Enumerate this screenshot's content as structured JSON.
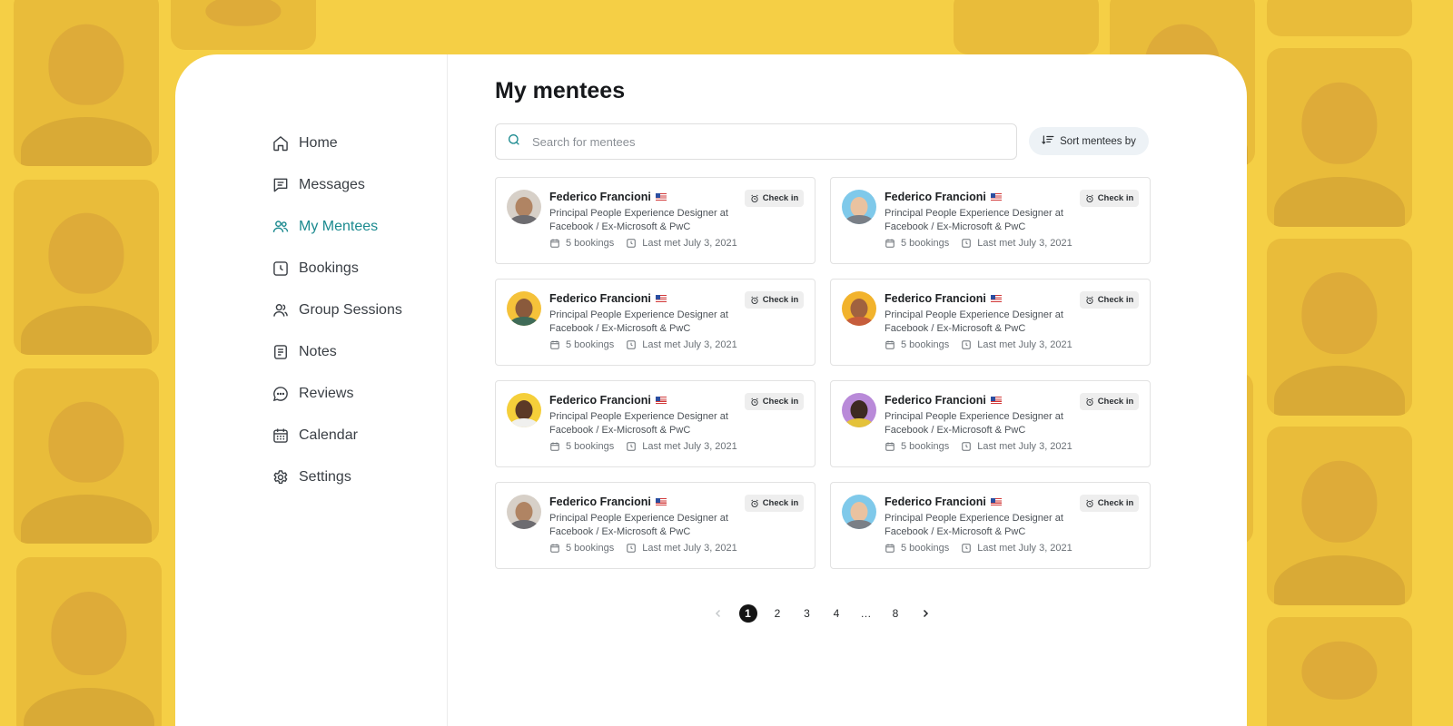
{
  "sidebar": {
    "items": [
      {
        "label": "Home",
        "icon": "home-icon"
      },
      {
        "label": "Messages",
        "icon": "message-icon"
      },
      {
        "label": "My Mentees",
        "icon": "users-icon",
        "active": true
      },
      {
        "label": "Bookings",
        "icon": "clock-icon"
      },
      {
        "label": "Group Sessions",
        "icon": "group-icon"
      },
      {
        "label": "Notes",
        "icon": "notes-icon"
      },
      {
        "label": "Reviews",
        "icon": "reviews-icon"
      },
      {
        "label": "Calendar",
        "icon": "calendar-icon"
      },
      {
        "label": "Settings",
        "icon": "gear-icon"
      }
    ]
  },
  "main": {
    "title": "My mentees",
    "search_placeholder": "Search for mentees",
    "sort_label": "Sort mentees by",
    "mentees": [
      {
        "name": "Federico Francioni",
        "role": "Principal People Experience Designer at Facebook / Ex-Microsoft & PwC",
        "bookings": "5 bookings",
        "last_met": "Last met July 3, 2021",
        "checkin": "Check in"
      },
      {
        "name": "Federico Francioni",
        "role": "Principal People Experience Designer at Facebook / Ex-Microsoft & PwC",
        "bookings": "5 bookings",
        "last_met": "Last met July 3, 2021",
        "checkin": "Check in"
      },
      {
        "name": "Federico Francioni",
        "role": "Principal People Experience Designer at Facebook / Ex-Microsoft & PwC",
        "bookings": "5 bookings",
        "last_met": "Last met July 3, 2021",
        "checkin": "Check in"
      },
      {
        "name": "Federico Francioni",
        "role": "Principal People Experience Designer at Facebook / Ex-Microsoft & PwC",
        "bookings": "5 bookings",
        "last_met": "Last met July 3, 2021",
        "checkin": "Check in"
      },
      {
        "name": "Federico Francioni",
        "role": "Principal People Experience Designer at Facebook / Ex-Microsoft & PwC",
        "bookings": "5 bookings",
        "last_met": "Last met July 3, 2021",
        "checkin": "Check in"
      },
      {
        "name": "Federico Francioni",
        "role": "Principal People Experience Designer at Facebook / Ex-Microsoft & PwC",
        "bookings": "5 bookings",
        "last_met": "Last met July 3, 2021",
        "checkin": "Check in"
      },
      {
        "name": "Federico Francioni",
        "role": "Principal People Experience Designer at Facebook / Ex-Microsoft & PwC",
        "bookings": "5 bookings",
        "last_met": "Last met July 3, 2021",
        "checkin": "Check in"
      },
      {
        "name": "Federico Francioni",
        "role": "Principal People Experience Designer at Facebook / Ex-Microsoft & PwC",
        "bookings": "5 bookings",
        "last_met": "Last met July 3, 2021",
        "checkin": "Check in"
      }
    ],
    "pagination": {
      "pages": [
        "1",
        "2",
        "3",
        "4",
        "…",
        "8"
      ],
      "current": "1"
    }
  },
  "colors": {
    "background": "#f5cf45",
    "accent": "#1b8a8f",
    "panel": "#ffffff"
  }
}
